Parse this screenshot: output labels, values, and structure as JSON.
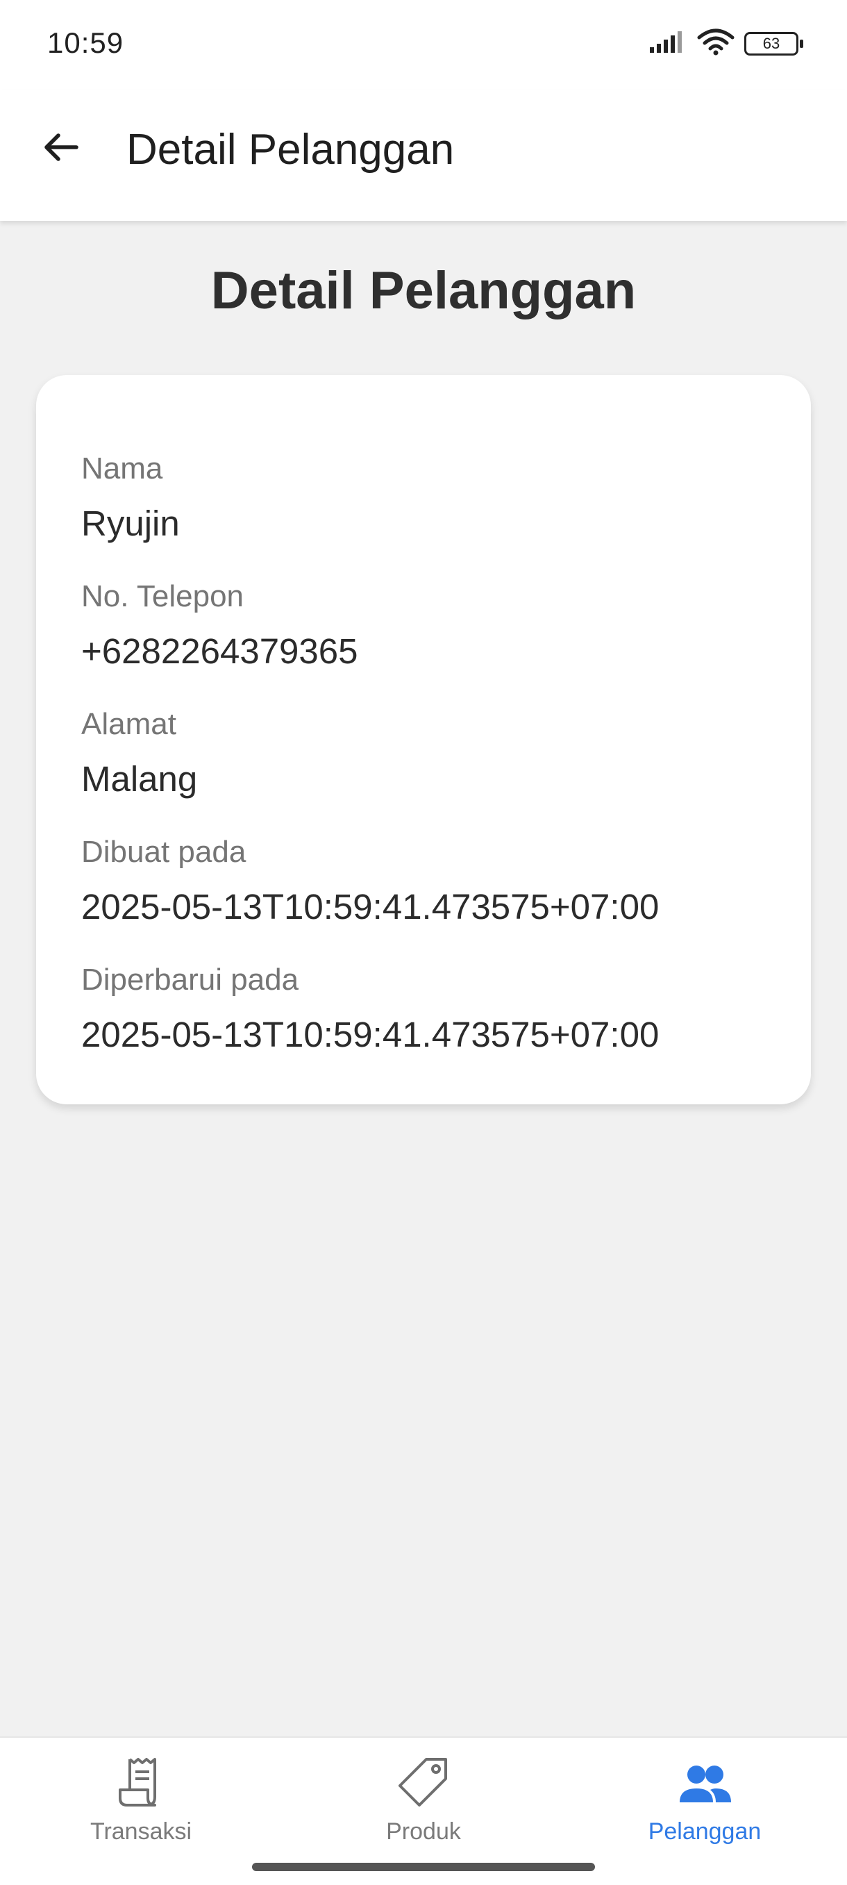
{
  "status_bar": {
    "time": "10:59",
    "battery": "63",
    "icons": [
      "signal-icon",
      "wifi-icon",
      "battery-icon"
    ]
  },
  "app_bar": {
    "title": "Detail Pelanggan",
    "back_icon": "arrow-left-icon"
  },
  "page": {
    "title": "Detail Pelanggan"
  },
  "customer": {
    "name_label": "Nama",
    "name_value": "Ryujin",
    "phone_label": "No. Telepon",
    "phone_value": "+6282264379365",
    "address_label": "Alamat",
    "address_value": "Malang",
    "created_label": "Dibuat pada",
    "created_value": "2025-05-13T10:59:41.473575+07:00",
    "updated_label": "Diperbarui pada",
    "updated_value": "2025-05-13T10:59:41.473575+07:00"
  },
  "bottom_nav": {
    "items": [
      {
        "label": "Transaksi",
        "icon": "receipt-icon",
        "active": false
      },
      {
        "label": "Produk",
        "icon": "tag-icon",
        "active": false
      },
      {
        "label": "Pelanggan",
        "icon": "people-icon",
        "active": true
      }
    ]
  },
  "colors": {
    "accent": "#2f7ae5",
    "background": "#f1f1f1",
    "card": "#ffffff",
    "label": "#757575",
    "text": "#2b2b2b"
  }
}
